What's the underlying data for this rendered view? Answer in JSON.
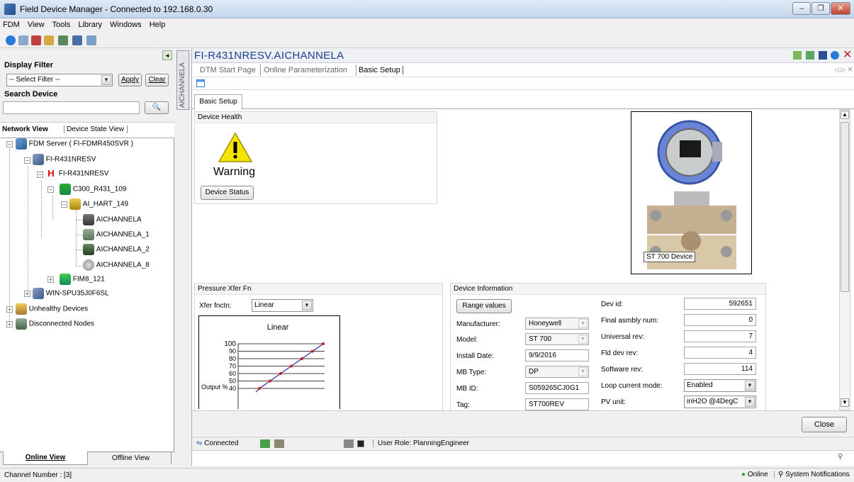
{
  "window": {
    "title": "Field Device Manager - Connected to 192.168.0.30"
  },
  "menu": [
    "FDM",
    "View",
    "Tools",
    "Library",
    "Windows",
    "Help"
  ],
  "left": {
    "display_filter_label": "Display Filter",
    "filter_value": "-- Select Filter --",
    "apply_label": "Apply",
    "clear_label": "Clear",
    "search_label": "Search Device",
    "tab_network": "Network View",
    "tab_state": "Device State View",
    "tree": {
      "server": "FDM Server ( FI-FDMR450SVR )",
      "n1": "FI-R431NRESV",
      "n2": "FI-R431NRESV",
      "n3": "C300_R431_109",
      "n4": "AI_HART_149",
      "ch1": "AICHANNELA",
      "ch2": "AICHANNELA_1",
      "ch3": "AICHANNELA_2",
      "ch4": "AICHANNELA_8",
      "fim": "FIM8_121",
      "win": "WIN-SPU35J0F6SL",
      "unhealthy": "Unhealthy Devices",
      "disconnected": "Disconnected Nodes"
    },
    "bottom_tab_online": "Online View",
    "bottom_tab_offline": "Offline View"
  },
  "main": {
    "vertical_label": "AICHANNELA",
    "title": "FI-R431NRESV.AICHANNELA",
    "tabs": [
      "DTM Start Page",
      "Online Parameterization",
      "Basic Setup"
    ],
    "subtab": "Basic Setup",
    "health": {
      "header": "Device Health",
      "status": "Warning",
      "button": "Device Status"
    },
    "image_caption": "ST 700 Device",
    "xfer": {
      "header": "Pressure Xfer Fn",
      "label": "Xfer fnctn:",
      "value": "Linear"
    },
    "info": {
      "header": "Device Information",
      "range_button": "Range values",
      "manufacturer_label": "Manufacturer:",
      "manufacturer": "Honeywell",
      "model_label": "Model:",
      "model": "ST 700",
      "install_label": "Install Date:",
      "install": "9/9/2016",
      "mbtype_label": "MB Type:",
      "mbtype": "DP",
      "mbid_label": "MB ID:",
      "mbid": "S059265CJ0G1",
      "tag_label": "Tag:",
      "tag": "ST700REV",
      "devid_label": "Dev id:",
      "devid": "592651",
      "final_label": "Final asmbly num:",
      "final": "0",
      "univ_label": "Universal rev:",
      "univ": "7",
      "flddev_label": "Fld dev rev:",
      "flddev": "4",
      "sw_label": "Software rev:",
      "sw": "114",
      "loop_label": "Loop current mode:",
      "loop": "Enabled",
      "pv_label": "PV unit:",
      "pv": "inH2O @4DegC"
    },
    "close_label": "Close",
    "status": {
      "connected": "Connected",
      "role": "User Role: PlanningEngineer"
    }
  },
  "chart_data": {
    "type": "line",
    "title": "Linear",
    "ylabel": "Output %",
    "y_ticks": [
      100,
      90,
      80,
      70,
      60,
      50,
      40
    ],
    "ylim": [
      40,
      100
    ],
    "series": [
      {
        "values": [
          [
            0.3,
            40
          ],
          [
            0.45,
            50
          ],
          [
            0.6,
            60
          ],
          [
            0.75,
            70
          ],
          [
            0.9,
            80
          ],
          [
            1.05,
            90
          ],
          [
            1.2,
            100
          ]
        ]
      }
    ]
  },
  "statusbar": {
    "channel": "Channel Number : [3]",
    "online": "Online",
    "notifications": "System Notifications"
  },
  "colors": {
    "title_blue": "#1a3f8f",
    "accent": "#0a246a"
  }
}
